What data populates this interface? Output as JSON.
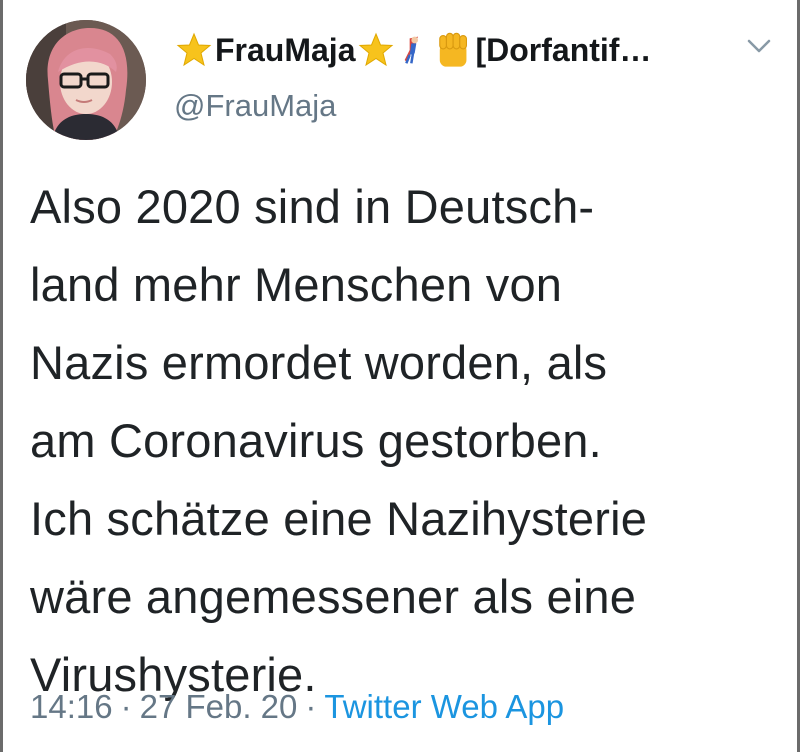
{
  "tweet": {
    "display_name": {
      "star_left": "⭐",
      "name": "FrauMaja",
      "star_right": "⭐",
      "superhero": "🦸",
      "fist": "✊",
      "rest": "[Dorfantif…"
    },
    "handle": "@FrauMaja",
    "text_lines": [
      "Also 2020 sind in Deutsch-",
      "land mehr Menschen von",
      "Nazis ermordet worden, als",
      "am Coronavirus gestorben.",
      "Ich schätze eine Nazihysterie",
      "wäre angemessener als eine",
      "Virushysterie."
    ],
    "time": "14:16",
    "separator": "·",
    "date": "27 Feb. 20",
    "source": "Twitter Web App"
  },
  "icons": {
    "avatar": "profile-photo",
    "caret": "chevron-down-icon"
  },
  "colors": {
    "text": "#14171a",
    "secondary": "#657786",
    "link": "#1b95e0",
    "star": "#f7c31c",
    "fist": "#f5b722"
  }
}
